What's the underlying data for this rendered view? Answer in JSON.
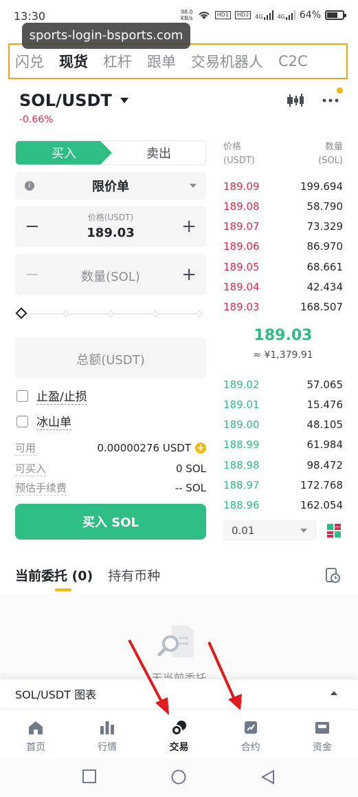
{
  "status_bar": {
    "time": "13:30",
    "net_speed_value": "98.0",
    "net_speed_unit": "KB/s",
    "hd1": "HD1",
    "hd2": "HD2",
    "sig1": "4G",
    "sig2": "4G",
    "battery": "64%"
  },
  "watermark": "sports-login-bsports.com",
  "top_tabs": [
    "闪兑",
    "现货",
    "杠杆",
    "跟单",
    "交易机器人",
    "C2C"
  ],
  "top_tabs_active_index": 1,
  "pair": {
    "name": "SOL/USDT",
    "change": "-0.66%"
  },
  "order_form": {
    "buy_tab": "买入",
    "sell_tab": "卖出",
    "order_type": "限价单",
    "price_label": "价格(USDT)",
    "price_value": "189.03",
    "quantity_placeholder": "数量(SOL)",
    "total_placeholder": "总额(USDT)",
    "tp_sl_label": "止盈/止损",
    "iceberg_label": "冰山单",
    "available_label": "可用",
    "available_value": "0.00000276 USDT",
    "can_buy_label": "可买入",
    "can_buy_value": "0 SOL",
    "fee_label": "预估手续费",
    "fee_value": "-- SOL",
    "buy_button": "买入 SOL"
  },
  "order_book": {
    "price_header_1": "价格",
    "price_header_2": "(USDT)",
    "qty_header_1": "数量",
    "qty_header_2": "(SOL)",
    "asks": [
      {
        "price": "189.09",
        "qty": "199.694"
      },
      {
        "price": "189.08",
        "qty": "58.790"
      },
      {
        "price": "189.07",
        "qty": "73.329"
      },
      {
        "price": "189.06",
        "qty": "86.970"
      },
      {
        "price": "189.05",
        "qty": "68.661"
      },
      {
        "price": "189.04",
        "qty": "42.434"
      },
      {
        "price": "189.03",
        "qty": "168.507"
      }
    ],
    "mid_price": "189.03",
    "mid_fiat": "≈ ¥1,379.91",
    "bids": [
      {
        "price": "189.02",
        "qty": "57.065"
      },
      {
        "price": "189.01",
        "qty": "15.476"
      },
      {
        "price": "189.00",
        "qty": "48.105"
      },
      {
        "price": "188.99",
        "qty": "61.984"
      },
      {
        "price": "188.98",
        "qty": "98.472"
      },
      {
        "price": "188.97",
        "qty": "172.768"
      },
      {
        "price": "188.96",
        "qty": "162.054"
      }
    ],
    "depth": "0.01"
  },
  "orders": {
    "tab_open": "当前委托 (0)",
    "tab_holdings": "持有币种",
    "empty_text": "无当前委托"
  },
  "chart_bar": "SOL/USDT 图表",
  "bottom_nav": [
    "首页",
    "行情",
    "交易",
    "合约",
    "资金"
  ],
  "bottom_nav_active_index": 2,
  "colors": {
    "buy": "#2ebd85",
    "sell": "#e0294a",
    "accent": "#f0b90b",
    "highlight_box": "#f0a21c",
    "annotation_arrow": "#e01b1b"
  }
}
